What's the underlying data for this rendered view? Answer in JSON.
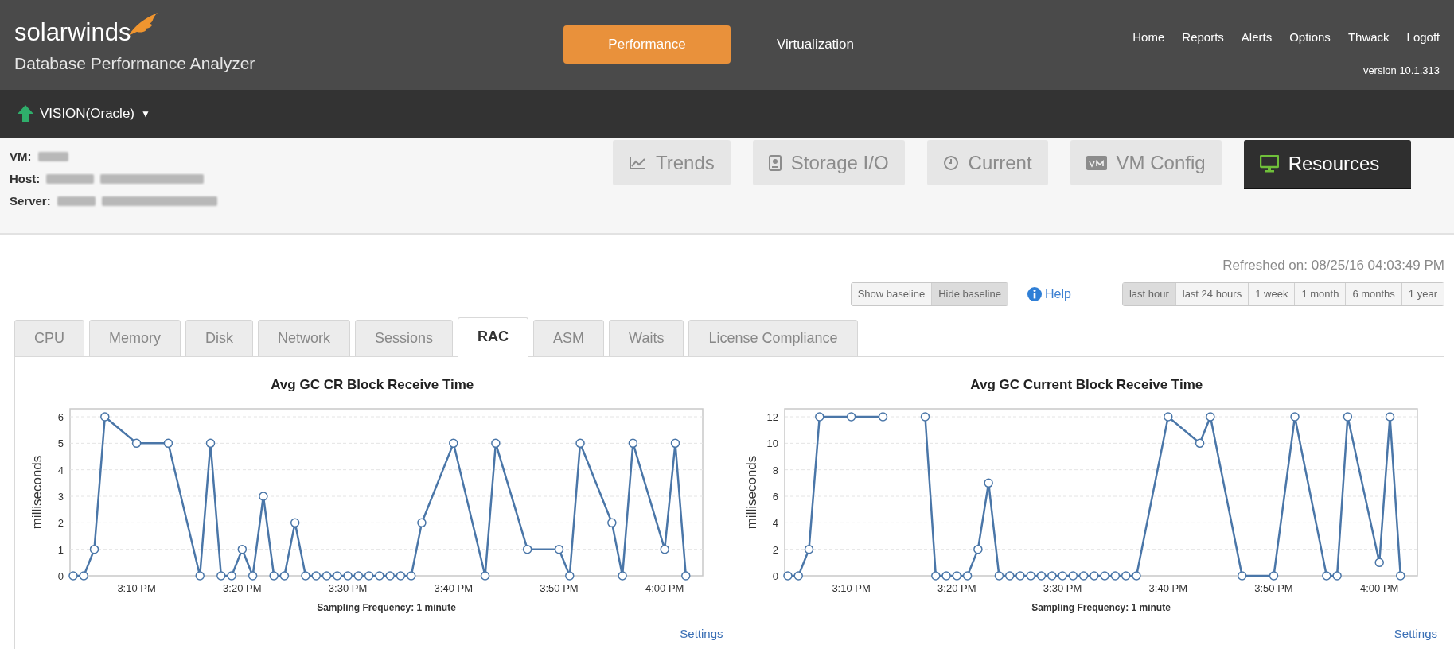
{
  "header": {
    "brand": "solarwinds",
    "product": "Database Performance Analyzer",
    "modes": [
      {
        "label": "Performance",
        "selected": true
      },
      {
        "label": "Virtualization",
        "selected": false
      }
    ],
    "links": [
      "Home",
      "Reports",
      "Alerts",
      "Options",
      "Thwack",
      "Logoff"
    ],
    "version": "version 10.1.313"
  },
  "instance": {
    "name": "VISION(Oracle)",
    "caret": "▼"
  },
  "info": [
    {
      "label": "VM:"
    },
    {
      "label": "Host:"
    },
    {
      "label": "Server:"
    }
  ],
  "views": [
    {
      "label": "Trends",
      "kind": "trend",
      "selected": false
    },
    {
      "label": "Storage I/O",
      "kind": "disk",
      "selected": false
    },
    {
      "label": "Current",
      "kind": "clock",
      "selected": false
    },
    {
      "label": "VM Config",
      "kind": "vm",
      "selected": false
    },
    {
      "label": "Resources",
      "kind": "monitor",
      "selected": true
    }
  ],
  "refreshed": "Refreshed on: 08/25/16 04:03:49 PM",
  "baseline": [
    {
      "label": "Show baseline",
      "selected": false
    },
    {
      "label": "Hide baseline",
      "selected": true
    }
  ],
  "help": "Help",
  "ranges": [
    {
      "label": "last hour",
      "selected": true
    },
    {
      "label": "last 24 hours",
      "selected": false
    },
    {
      "label": "1 week",
      "selected": false
    },
    {
      "label": "1 month",
      "selected": false
    },
    {
      "label": "6 months",
      "selected": false
    },
    {
      "label": "1 year",
      "selected": false
    }
  ],
  "tabs": [
    {
      "label": "CPU",
      "selected": false
    },
    {
      "label": "Memory",
      "selected": false
    },
    {
      "label": "Disk",
      "selected": false
    },
    {
      "label": "Network",
      "selected": false
    },
    {
      "label": "Sessions",
      "selected": false
    },
    {
      "label": "RAC",
      "selected": true
    },
    {
      "label": "ASM",
      "selected": false
    },
    {
      "label": "Waits",
      "selected": false
    },
    {
      "label": "License Compliance",
      "selected": false
    }
  ],
  "charts": [
    {
      "settings": "Settings",
      "chart_data": {
        "type": "line",
        "title": "Avg GC CR Block Receive Time",
        "xlabel": "Sampling Frequency: 1 minute",
        "ylabel": "milliseconds",
        "grid": true,
        "x": [
          904,
          905,
          906,
          907,
          910,
          913,
          916,
          917,
          918,
          919,
          920,
          921,
          922,
          923,
          924,
          925,
          926,
          927,
          928,
          929,
          930,
          931,
          932,
          933,
          934,
          935,
          936,
          937,
          940,
          943,
          944,
          947,
          950,
          951,
          952,
          955,
          956,
          957,
          960,
          961,
          962
        ],
        "series": [
          {
            "color": "#4a76a8",
            "marker": true,
            "values": [
              0,
              0,
              1,
              6,
              5,
              5,
              0,
              5,
              0,
              0,
              1,
              0,
              3,
              0,
              0,
              2,
              0,
              0,
              0,
              0,
              0,
              0,
              0,
              0,
              0,
              0,
              0,
              2,
              5,
              0,
              5,
              1,
              1,
              0,
              5,
              2,
              0,
              5,
              1,
              5,
              0
            ]
          }
        ],
        "xlim": [
          903.7,
          963.6
        ],
        "ylim": [
          0,
          6.3
        ],
        "xticks": [
          {
            "value": 910,
            "label": "3:10 PM"
          },
          {
            "value": 920,
            "label": "3:20 PM"
          },
          {
            "value": 930,
            "label": "3:30 PM"
          },
          {
            "value": 940,
            "label": "3:40 PM"
          },
          {
            "value": 950,
            "label": "3:50 PM"
          },
          {
            "value": 960,
            "label": "4:00 PM"
          }
        ],
        "yticks": [
          0,
          1,
          2,
          3,
          4,
          5,
          6
        ]
      }
    },
    {
      "settings": "Settings",
      "chart_data": {
        "type": "line",
        "title": "Avg GC Current Block Receive Time",
        "xlabel": "Sampling Frequency: 1 minute",
        "ylabel": "milliseconds",
        "grid": true,
        "x": [
          904,
          905,
          906,
          907,
          910,
          913,
          915,
          917,
          918,
          919,
          920,
          921,
          922,
          923,
          924,
          925,
          926,
          927,
          928,
          929,
          930,
          931,
          932,
          933,
          934,
          935,
          936,
          937,
          940,
          943,
          944,
          947,
          950,
          952,
          955,
          956,
          957,
          960,
          961,
          962
        ],
        "series": [
          {
            "color": "#4a76a8",
            "marker": true,
            "values": [
              0,
              0,
              2,
              12,
              12,
              12,
              null,
              12,
              0,
              0,
              0,
              0,
              2,
              7,
              0,
              0,
              0,
              0,
              0,
              0,
              0,
              0,
              0,
              0,
              0,
              0,
              0,
              0,
              12,
              10,
              12,
              0,
              0,
              12,
              0,
              0,
              12,
              1,
              12,
              0
            ]
          }
        ],
        "xlim": [
          903.7,
          963.6
        ],
        "ylim": [
          0,
          12.6
        ],
        "xticks": [
          {
            "value": 910,
            "label": "3:10 PM"
          },
          {
            "value": 920,
            "label": "3:20 PM"
          },
          {
            "value": 930,
            "label": "3:30 PM"
          },
          {
            "value": 940,
            "label": "3:40 PM"
          },
          {
            "value": 950,
            "label": "3:50 PM"
          },
          {
            "value": 960,
            "label": "4:00 PM"
          }
        ],
        "yticks": [
          0,
          2,
          4,
          6,
          8,
          10,
          12
        ]
      }
    }
  ]
}
